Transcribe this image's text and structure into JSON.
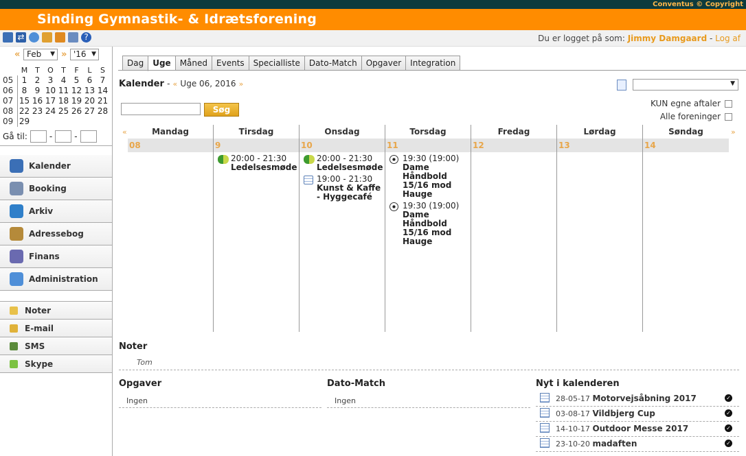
{
  "header": {
    "title": "Sinding Gymnastik- & Idrætsforening",
    "copyright": "Conventus © Copyright"
  },
  "toolbar": {
    "login_prefix": "Du er logget på som:",
    "user": "Jimmy Damgaard",
    "separator": "-",
    "logout": "Log af"
  },
  "mini_calendar": {
    "prev": "«",
    "next": "»",
    "month": "Feb",
    "year": "'16",
    "weekday_headers": [
      "M",
      "T",
      "O",
      "T",
      "F",
      "L",
      "S"
    ],
    "weeks": [
      {
        "wk": "05",
        "days": [
          "1",
          "2",
          "3",
          "4",
          "5",
          "6",
          "7"
        ]
      },
      {
        "wk": "06",
        "days": [
          "8",
          "9",
          "10",
          "11",
          "12",
          "13",
          "14"
        ]
      },
      {
        "wk": "07",
        "days": [
          "15",
          "16",
          "17",
          "18",
          "19",
          "20",
          "21"
        ]
      },
      {
        "wk": "08",
        "days": [
          "22",
          "23",
          "24",
          "25",
          "26",
          "27",
          "28"
        ]
      },
      {
        "wk": "09",
        "days": [
          "29",
          "",
          "",
          "",
          "",
          "",
          ""
        ]
      }
    ],
    "goto_label": "Gå til:",
    "goto_sep": "-"
  },
  "modules": [
    {
      "label": "Kalender",
      "color": "#3b6fb6"
    },
    {
      "label": "Booking",
      "color": "#7a8fb0"
    },
    {
      "label": "Arkiv",
      "color": "#2f7fc9"
    },
    {
      "label": "Adressebog",
      "color": "#b58a3a"
    },
    {
      "label": "Finans",
      "color": "#6a6ab0"
    },
    {
      "label": "Administration",
      "color": "#4f8fd8"
    }
  ],
  "tools": [
    {
      "label": "Noter",
      "color": "#e8c14a"
    },
    {
      "label": "E-mail",
      "color": "#e0b23a"
    },
    {
      "label": "SMS",
      "color": "#5a8a3a"
    },
    {
      "label": "Skype",
      "color": "#7cc242"
    }
  ],
  "tabs": [
    "Dag",
    "Uge",
    "Måned",
    "Events",
    "Specialliste",
    "Dato-Match",
    "Opgaver",
    "Integration"
  ],
  "calendar": {
    "heading": "Kalender",
    "dash": "-",
    "prev": "«",
    "next": "»",
    "week_label": "Uge 06, 2016",
    "search_button": "Søg",
    "only_own": "KUN egne aftaler",
    "all_assoc": "Alle foreninger",
    "days": [
      {
        "name": "Mandag",
        "date": "08",
        "events": []
      },
      {
        "name": "Tirsdag",
        "date": "9",
        "events": [
          {
            "icon": "grp",
            "time": "20:00 - 21:30",
            "name": "Ledelsesmøde"
          }
        ]
      },
      {
        "name": "Onsdag",
        "date": "10",
        "events": [
          {
            "icon": "grp",
            "time": "20:00 - 21:30",
            "name": "Ledelsesmøde"
          },
          {
            "icon": "cal",
            "time": "19:00 - 21:30",
            "name": "Kunst & Kaffe - Hyggecafé"
          }
        ]
      },
      {
        "name": "Torsdag",
        "date": "11",
        "events": [
          {
            "icon": "ball",
            "time": "19:30 (19:00)",
            "name": "Dame Håndbold 15/16 mod Hauge"
          },
          {
            "icon": "ball",
            "time": "19:30 (19:00)",
            "name": "Dame Håndbold 15/16 mod Hauge"
          }
        ]
      },
      {
        "name": "Fredag",
        "date": "12",
        "events": []
      },
      {
        "name": "Lørdag",
        "date": "13",
        "events": []
      },
      {
        "name": "Søndag",
        "date": "14",
        "events": []
      }
    ]
  },
  "noter": {
    "title": "Noter",
    "body": "Tom"
  },
  "opgaver": {
    "title": "Opgaver",
    "body": "Ingen"
  },
  "dato_match": {
    "title": "Dato-Match",
    "body": "Ingen"
  },
  "nyt": {
    "title": "Nyt i kalenderen",
    "items": [
      {
        "date": "28-05-17",
        "name": "Motorvejsåbning 2017"
      },
      {
        "date": "03-08-17",
        "name": "Vildbjerg Cup"
      },
      {
        "date": "14-10-17",
        "name": "Outdoor Messe 2017"
      },
      {
        "date": "23-10-20",
        "name": "madaften"
      }
    ]
  }
}
